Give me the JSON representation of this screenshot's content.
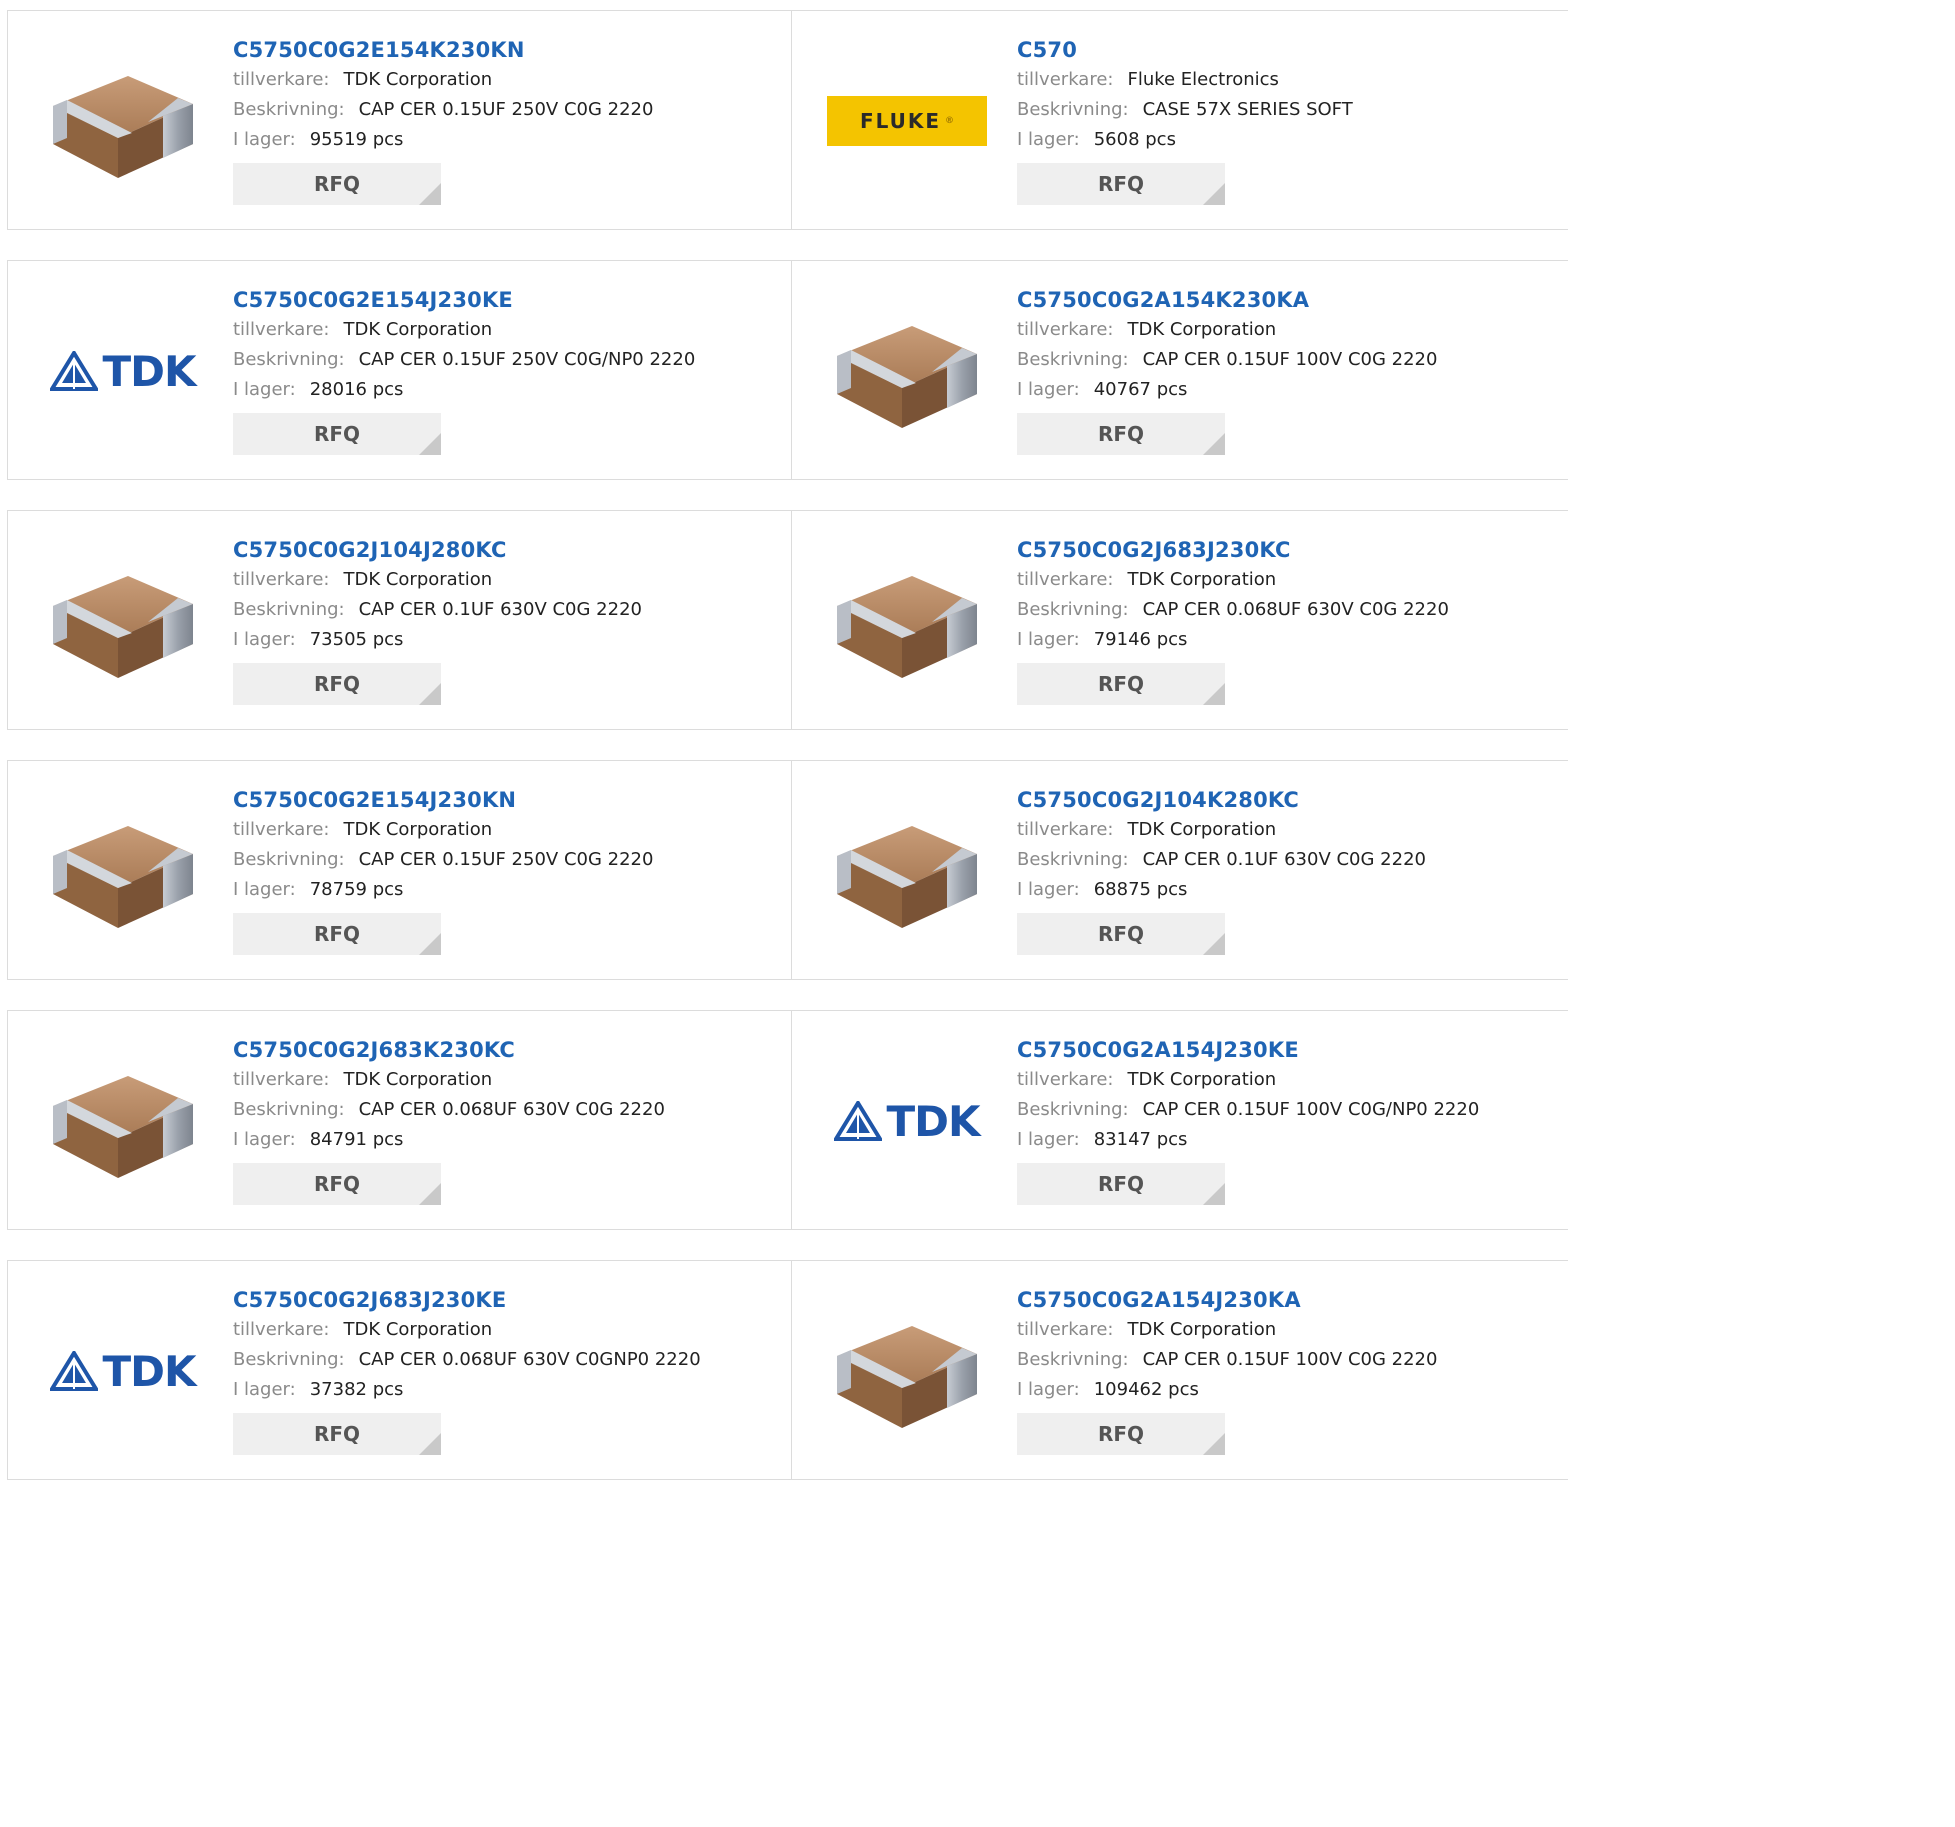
{
  "labels": {
    "manufacturer": "tillverkare:",
    "description": "Beskrivning:",
    "stock": "I lager:",
    "rfq": "RFQ"
  },
  "logo_text": {
    "fluke": "FLUKE",
    "tdk": "TDK"
  },
  "colors": {
    "link": "#1f64b4",
    "capacitor_body": "#a87a55",
    "capacitor_terminal": "#a9afb8",
    "fluke_yellow": "#f4c400",
    "tdk_blue": "#1e55a8"
  },
  "products": [
    {
      "part": "C5750C0G2E154K230KN",
      "manufacturer": "TDK Corporation",
      "description": "CAP CER 0.15UF 250V C0G 2220",
      "stock": "95519 pcs",
      "image": "capacitor"
    },
    {
      "part": "C570",
      "manufacturer": "Fluke Electronics",
      "description": "CASE 57X SERIES SOFT",
      "stock": "5608 pcs",
      "image": "fluke-logo"
    },
    {
      "part": "C5750C0G2E154J230KE",
      "manufacturer": "TDK Corporation",
      "description": "CAP CER 0.15UF 250V C0G/NP0 2220",
      "stock": "28016 pcs",
      "image": "tdk-logo"
    },
    {
      "part": "C5750C0G2A154K230KA",
      "manufacturer": "TDK Corporation",
      "description": "CAP CER 0.15UF 100V C0G 2220",
      "stock": "40767 pcs",
      "image": "capacitor"
    },
    {
      "part": "C5750C0G2J104J280KC",
      "manufacturer": "TDK Corporation",
      "description": "CAP CER 0.1UF 630V C0G 2220",
      "stock": "73505 pcs",
      "image": "capacitor"
    },
    {
      "part": "C5750C0G2J683J230KC",
      "manufacturer": "TDK Corporation",
      "description": "CAP CER 0.068UF 630V C0G 2220",
      "stock": "79146 pcs",
      "image": "capacitor"
    },
    {
      "part": "C5750C0G2E154J230KN",
      "manufacturer": "TDK Corporation",
      "description": "CAP CER 0.15UF 250V C0G 2220",
      "stock": "78759 pcs",
      "image": "capacitor"
    },
    {
      "part": "C5750C0G2J104K280KC",
      "manufacturer": "TDK Corporation",
      "description": "CAP CER 0.1UF 630V C0G 2220",
      "stock": "68875 pcs",
      "image": "capacitor"
    },
    {
      "part": "C5750C0G2J683K230KC",
      "manufacturer": "TDK Corporation",
      "description": "CAP CER 0.068UF 630V C0G 2220",
      "stock": "84791 pcs",
      "image": "capacitor"
    },
    {
      "part": "C5750C0G2A154J230KE",
      "manufacturer": "TDK Corporation",
      "description": "CAP CER 0.15UF 100V C0G/NP0 2220",
      "stock": "83147 pcs",
      "image": "tdk-logo"
    },
    {
      "part": "C5750C0G2J683J230KE",
      "manufacturer": "TDK Corporation",
      "description": "CAP CER 0.068UF 630V C0GNP0 2220",
      "stock": "37382 pcs",
      "image": "tdk-logo"
    },
    {
      "part": "C5750C0G2A154J230KA",
      "manufacturer": "TDK Corporation",
      "description": "CAP CER 0.15UF 100V C0G 2220",
      "stock": "109462 pcs",
      "image": "capacitor"
    }
  ]
}
